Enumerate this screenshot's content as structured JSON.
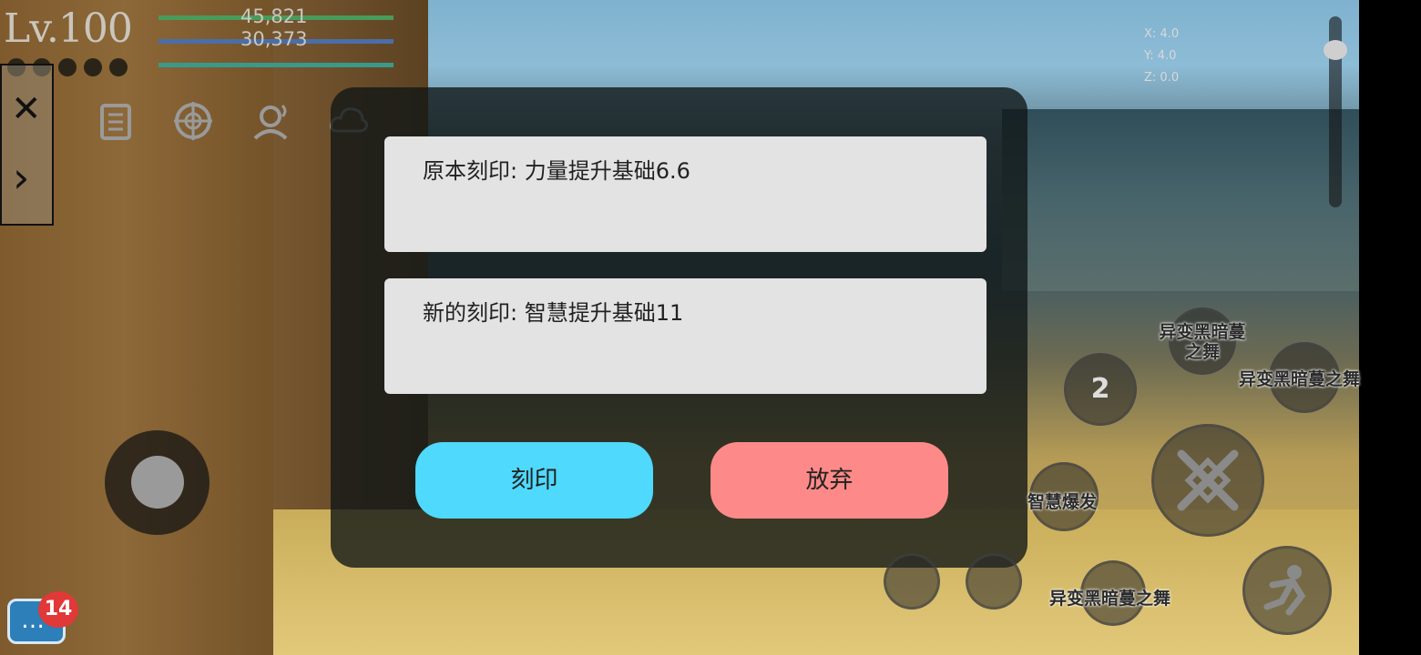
{
  "hud": {
    "level": "Lv.100",
    "hp_value": "45,821",
    "mp_value": "30,373",
    "colors": {
      "hp": "#4a9a5a",
      "mp": "#4a6ea8",
      "xp": "#3a9a8a"
    }
  },
  "coords": {
    "x": "X: 4.0",
    "y": "Y: 4.0",
    "z": "Z: 0.0"
  },
  "dialog": {
    "original_engraving": "原本刻印: 力量提升基础6.6",
    "new_engraving": "新的刻印: 智慧提升基础11",
    "engrave_label": "刻印",
    "abandon_label": "放弃",
    "colors": {
      "engrave": "#4fd9fc",
      "abandon": "#fd8a88"
    }
  },
  "skills": {
    "top_label": "异变黑暗蔓之舞",
    "right_label": "异变黑暗蔓之舞",
    "middle_label": "智慧爆发",
    "bottom_label": "异变黑暗蔓之舞",
    "slot_number": "2"
  },
  "chat": {
    "badge_count": "14"
  },
  "icons": [
    "close-icon",
    "chevron-right-icon",
    "scroll-icon",
    "target-icon",
    "support-icon",
    "cloud-icon",
    "chat-icon",
    "attack-icon",
    "dash-icon"
  ]
}
